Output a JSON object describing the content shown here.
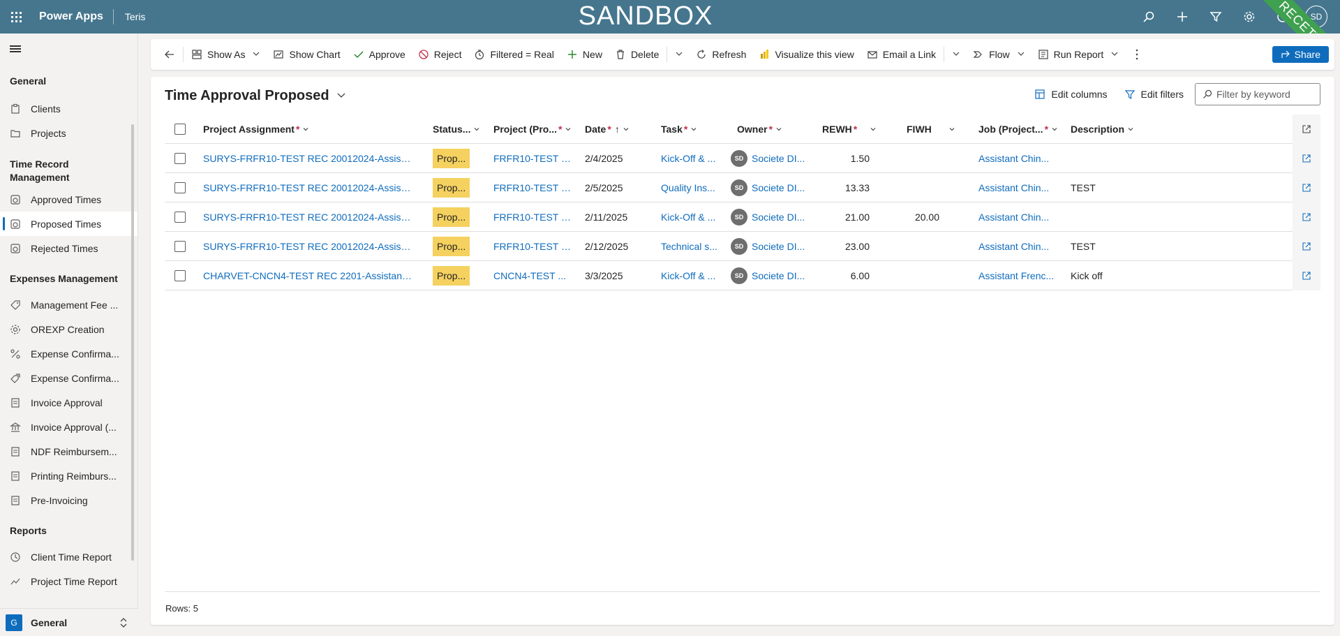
{
  "header": {
    "app_name": "Power Apps",
    "environment": "Teris",
    "banner": "SANDBOX",
    "ribbon": "RECETTE",
    "user_initials": "SD",
    "brand_color": "#45768e"
  },
  "sidebar": {
    "groups": [
      {
        "title": "General",
        "items": [
          {
            "label": "Clients",
            "icon": "clipboard-icon"
          },
          {
            "label": "Projects",
            "icon": "folder-icon"
          }
        ]
      },
      {
        "title": "Time Record Management",
        "items": [
          {
            "label": "Approved Times",
            "icon": "timer-icon"
          },
          {
            "label": "Proposed Times",
            "icon": "timer-icon",
            "active": true
          },
          {
            "label": "Rejected Times",
            "icon": "timer-icon"
          }
        ]
      },
      {
        "title": "Expenses Management",
        "items": [
          {
            "label": "Management Fee ...",
            "icon": "tag-icon"
          },
          {
            "label": "OREXP Creation",
            "icon": "gear-icon"
          },
          {
            "label": "Expense Confirma...",
            "icon": "link-icon"
          },
          {
            "label": "Expense Confirma...",
            "icon": "tags-icon"
          },
          {
            "label": "Invoice Approval",
            "icon": "document-icon"
          },
          {
            "label": "Invoice Approval (...",
            "icon": "bank-icon"
          },
          {
            "label": "NDF Reimbursem...",
            "icon": "document-icon"
          },
          {
            "label": "Printing Reimburs...",
            "icon": "document-icon"
          },
          {
            "label": "Pre-Invoicing",
            "icon": "document-icon"
          }
        ]
      },
      {
        "title": "Reports",
        "items": [
          {
            "label": "Client Time Report",
            "icon": "clock-icon"
          },
          {
            "label": "Project Time Report",
            "icon": "trend-icon"
          }
        ]
      }
    ],
    "area": {
      "badge": "G",
      "name": "General"
    }
  },
  "commands": {
    "show_as": "Show As",
    "show_chart": "Show Chart",
    "approve": "Approve",
    "reject": "Reject",
    "filtered": "Filtered = Real",
    "new": "New",
    "delete": "Delete",
    "refresh": "Refresh",
    "visualize": "Visualize this view",
    "email_link": "Email a Link",
    "flow": "Flow",
    "run_report": "Run Report",
    "share": "Share"
  },
  "view": {
    "title": "Time Approval Proposed",
    "edit_columns": "Edit columns",
    "edit_filters": "Edit filters",
    "filter_placeholder": "Filter by keyword",
    "rows_label": "Rows: 5"
  },
  "columns": {
    "assignment": "Project Assignment",
    "status": "Status...",
    "project": "Project (Pro...",
    "date": "Date",
    "task": "Task",
    "owner": "Owner",
    "rewh": "REWH",
    "fiwh": "FIWH",
    "job": "Job (Project...",
    "description": "Description",
    "required_marker": "*",
    "sort_arrow": "↑"
  },
  "rows": [
    {
      "assignment": "SURYS-FRFR10-TEST REC 20012024-Assistant ...",
      "status": "Prop...",
      "project": "FRFR10-TEST R...",
      "date": "2/4/2025",
      "task": "Kick-Off & ...",
      "owner_initials": "SD",
      "owner": "Societe DI...",
      "rewh": "1.50",
      "fiwh": "",
      "job": "Assistant Chin...",
      "description": ""
    },
    {
      "assignment": "SURYS-FRFR10-TEST REC 20012024-Assistant ...",
      "status": "Prop...",
      "project": "FRFR10-TEST R...",
      "date": "2/5/2025",
      "task": "Quality Ins...",
      "owner_initials": "SD",
      "owner": "Societe DI...",
      "rewh": "13.33",
      "fiwh": "",
      "job": "Assistant Chin...",
      "description": "TEST"
    },
    {
      "assignment": "SURYS-FRFR10-TEST REC 20012024-Assistant ...",
      "status": "Prop...",
      "project": "FRFR10-TEST R...",
      "date": "2/11/2025",
      "task": "Kick-Off & ...",
      "owner_initials": "SD",
      "owner": "Societe DI...",
      "rewh": "21.00",
      "fiwh": "20.00",
      "job": "Assistant Chin...",
      "description": ""
    },
    {
      "assignment": "SURYS-FRFR10-TEST REC 20012024-Assistant ...",
      "status": "Prop...",
      "project": "FRFR10-TEST R...",
      "date": "2/12/2025",
      "task": "Technical s...",
      "owner_initials": "SD",
      "owner": "Societe DI...",
      "rewh": "23.00",
      "fiwh": "",
      "job": "Assistant Chin...",
      "description": "TEST"
    },
    {
      "assignment": "CHARVET-CNCN4-TEST REC 2201-Assistant Fre...",
      "status": "Prop...",
      "project": "CNCN4-TEST ...",
      "date": "3/3/2025",
      "task": "Kick-Off & ...",
      "owner_initials": "SD",
      "owner": "Societe DI...",
      "rewh": "6.00",
      "fiwh": "",
      "job": "Assistant Frenc...",
      "description": "Kick off"
    }
  ]
}
